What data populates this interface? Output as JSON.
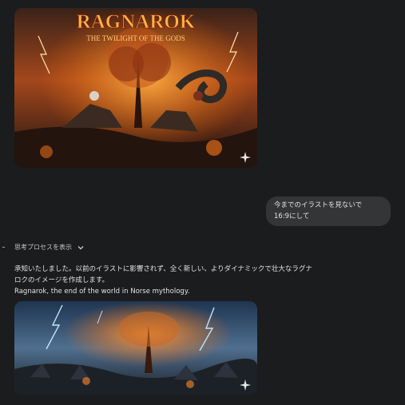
{
  "image1": {
    "title": "RAGNAROK",
    "subtitle": "THE TWILIGHT OF THE GODS"
  },
  "user_message": {
    "line1": "今までのイラストを見ないで",
    "line2": "16:9にして"
  },
  "thinking": {
    "label": "思考プロセスを表示"
  },
  "response": {
    "line1": "承知いたしました。以前のイラストに影響されず、全く新しい、よりダイナミックで壮大なラグナ",
    "line2": "ロクのイメージを作成します。",
    "line3": "Ragnarok, the end of the world in Norse mythology."
  }
}
